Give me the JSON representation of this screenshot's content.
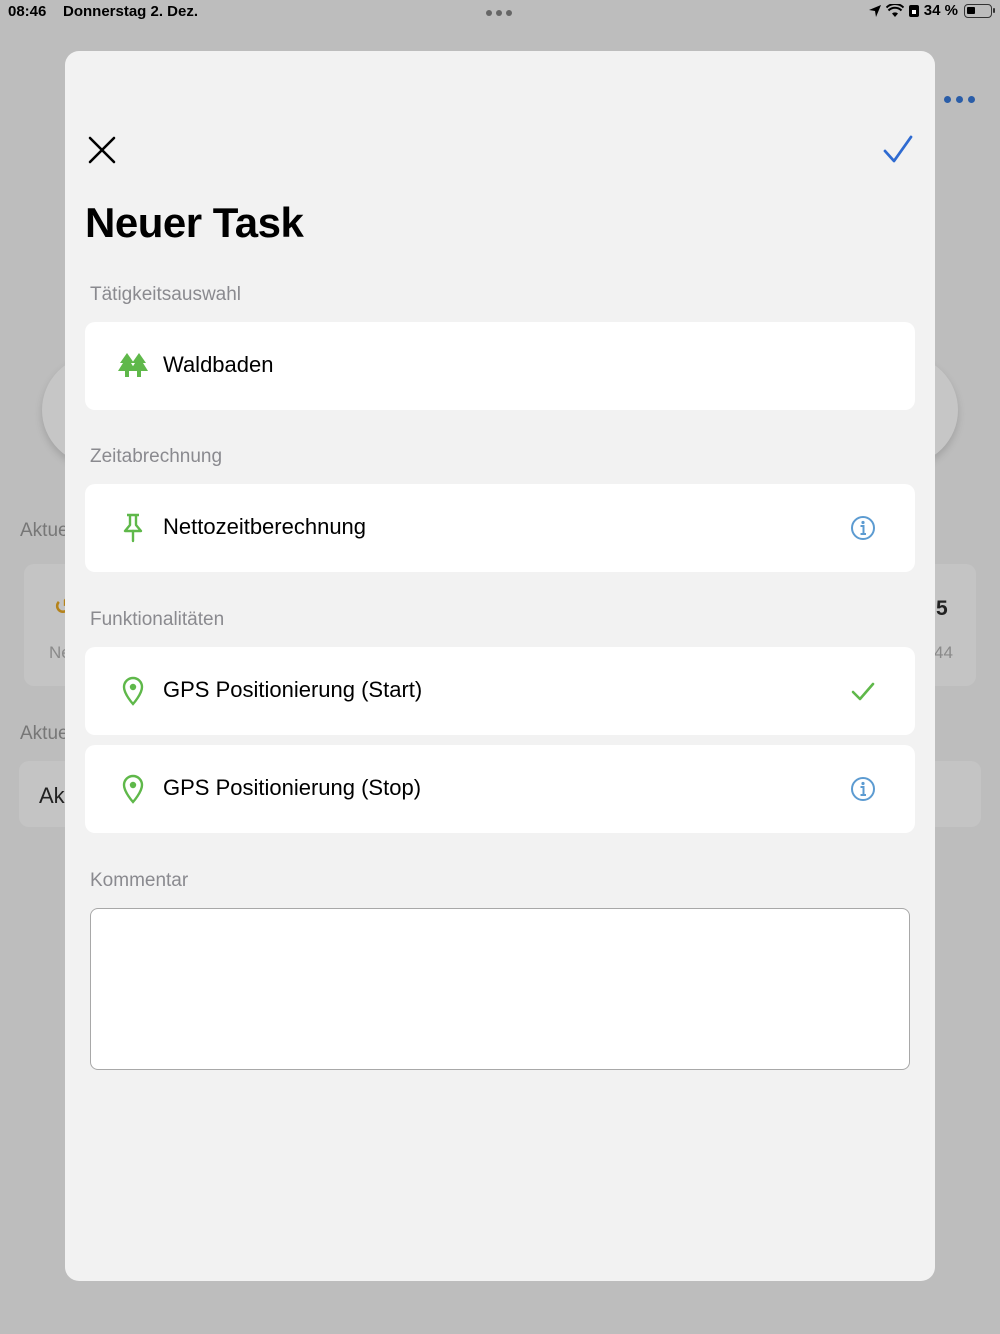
{
  "status_bar": {
    "time": "08:46",
    "date": "Donnerstag 2. Dez.",
    "battery": "34 %"
  },
  "background": {
    "label_aktuell_1": "Aktue",
    "label_aktuell_2": "Aktue",
    "stat_left_label": "Ne",
    "stat_right_value": "5",
    "stat_right_label": "44",
    "list_item_text": "Ak"
  },
  "sheet": {
    "title": "Neuer Task",
    "sections": {
      "activity": "Tätigkeitsauswahl",
      "time": "Zeitabrechnung",
      "features": "Funktionalitäten",
      "comment": "Kommentar"
    },
    "activity": {
      "label": "Waldbaden",
      "icon": "trees-icon"
    },
    "time_billing": {
      "label": "Nettozeitberechnung",
      "icon": "pin-icon",
      "accessory": "info-icon"
    },
    "features": [
      {
        "label": "GPS Positionierung (Start)",
        "icon": "location-pin-icon",
        "accessory": "checkmark-icon"
      },
      {
        "label": "GPS Positionierung (Stop)",
        "icon": "location-pin-icon",
        "accessory": "info-icon"
      }
    ],
    "comment": {
      "value": "",
      "placeholder": ""
    }
  },
  "colors": {
    "accent_blue": "#2f6bd1",
    "green_icon": "#5fb84a",
    "info_blue": "#5c9bd1",
    "overlay_bg": "#bdbdbd",
    "sheet_bg": "#f2f2f2"
  }
}
